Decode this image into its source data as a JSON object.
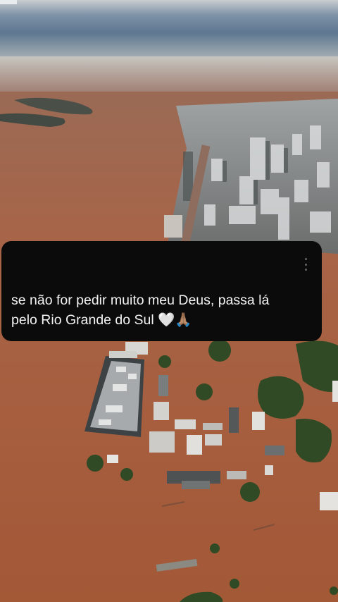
{
  "post": {
    "line1": "se não for pedir muito meu Deus, passa lá",
    "line2": "pelo Rio Grande do Sul 🤍🙏🏽"
  },
  "photo": {
    "subject": "aerial view of a flooded city with brown floodwater",
    "colors": {
      "sky": "#7a8ea4",
      "water": "#a5603f",
      "tree": "#2e4a22",
      "card": "#0b0b0b"
    }
  },
  "icons": {
    "more": "more-vertical-icon"
  }
}
